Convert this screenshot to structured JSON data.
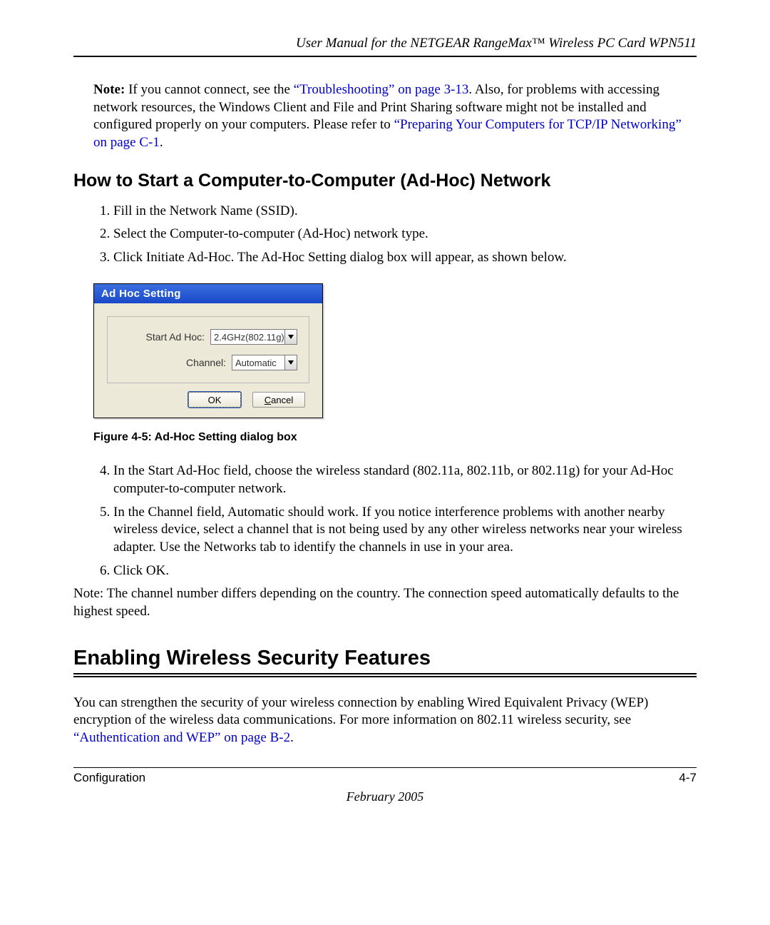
{
  "header": {
    "title": "User Manual for the NETGEAR RangeMax™ Wireless PC Card WPN511"
  },
  "note1": {
    "label": "Note:",
    "pre": " If you cannot connect, see the ",
    "link1": "“Troubleshooting” on page 3-13",
    "mid": ". Also, for problems with accessing network resources, the Windows Client and File and Print Sharing software might not be installed and configured properly on your computers. Please refer to ",
    "link2": "“Preparing Your Computers for TCP/IP Networking” on page C-1",
    "post": "."
  },
  "h_adhoc": "How to Start a Computer-to-Computer (Ad-Hoc) Network",
  "steps_a": [
    "Fill in the Network Name (SSID).",
    "Select the Computer-to-computer (Ad-Hoc) network type.",
    "Click Initiate Ad-Hoc. The Ad-Hoc Setting dialog box will appear, as shown below."
  ],
  "dialog": {
    "title": "Ad Hoc Setting",
    "field1_label": "Start Ad Hoc:",
    "field1_value": "2.4GHz(802.11g)",
    "field2_label": "Channel:",
    "field2_value": "Automatic",
    "ok": "OK",
    "cancel_u": "C",
    "cancel_rest": "ancel"
  },
  "fig_caption": "Figure 4-5:  Ad-Hoc Setting dialog box",
  "steps_b": [
    "In the Start Ad-Hoc field, choose the wireless standard (802.11a, 802.11b, or 802.11g) for your Ad-Hoc computer-to-computer network.",
    "In the Channel field, Automatic should work. If you notice interference problems with another nearby wireless device, select a channel that is not being used by any other wireless networks near your wireless adapter. Use the Networks tab to identify the channels in use in your area.",
    "Click OK."
  ],
  "note2": {
    "label": "Note:",
    "text": " The channel number differs depending on the country. The connection speed automatically defaults to the highest speed."
  },
  "h_security": "Enabling Wireless Security Features",
  "security_para": {
    "pre": "You can strengthen the security of your wireless connection by enabling Wired Equivalent Privacy (WEP) encryption of the wireless data communications. For more information on 802.11 wireless security, see ",
    "link": "“Authentication and WEP” on page B-2",
    "post": "."
  },
  "footer": {
    "left": "Configuration",
    "right": "4-7",
    "date": "February 2005"
  }
}
